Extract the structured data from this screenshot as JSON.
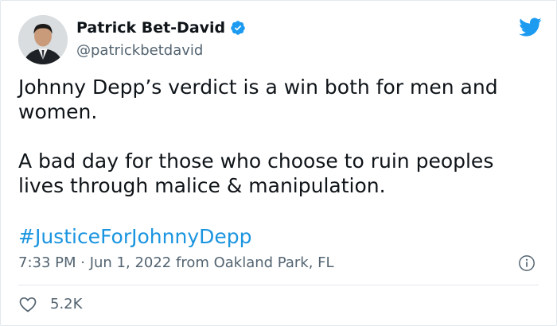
{
  "author": {
    "display_name": "Patrick Bet-David",
    "handle": "@patrickbetdavid",
    "verified": true,
    "avatar_icon": "profile-photo"
  },
  "tweet": {
    "paragraphs": [
      "Johnny Depp’s verdict is a win both for men and women.",
      "A bad day for those who choose to ruin peoples lives through malice & manipulation."
    ],
    "hashtag": "#JusticeForJohnnyDepp"
  },
  "meta": {
    "time": "7:33 PM",
    "separator": " · ",
    "date": "Jun 1, 2022",
    "source": " from Oakland Park, FL"
  },
  "engagement": {
    "likes": "5.2K"
  },
  "colors": {
    "link": "#1b95e0",
    "twitter_blue": "#1d9bf0",
    "text": "#0f1419",
    "muted": "#536471",
    "border": "#e1e8ed"
  },
  "icons": {
    "brand": "twitter-bird-icon",
    "verified": "verified-badge-icon",
    "info": "info-icon",
    "like": "heart-icon"
  }
}
